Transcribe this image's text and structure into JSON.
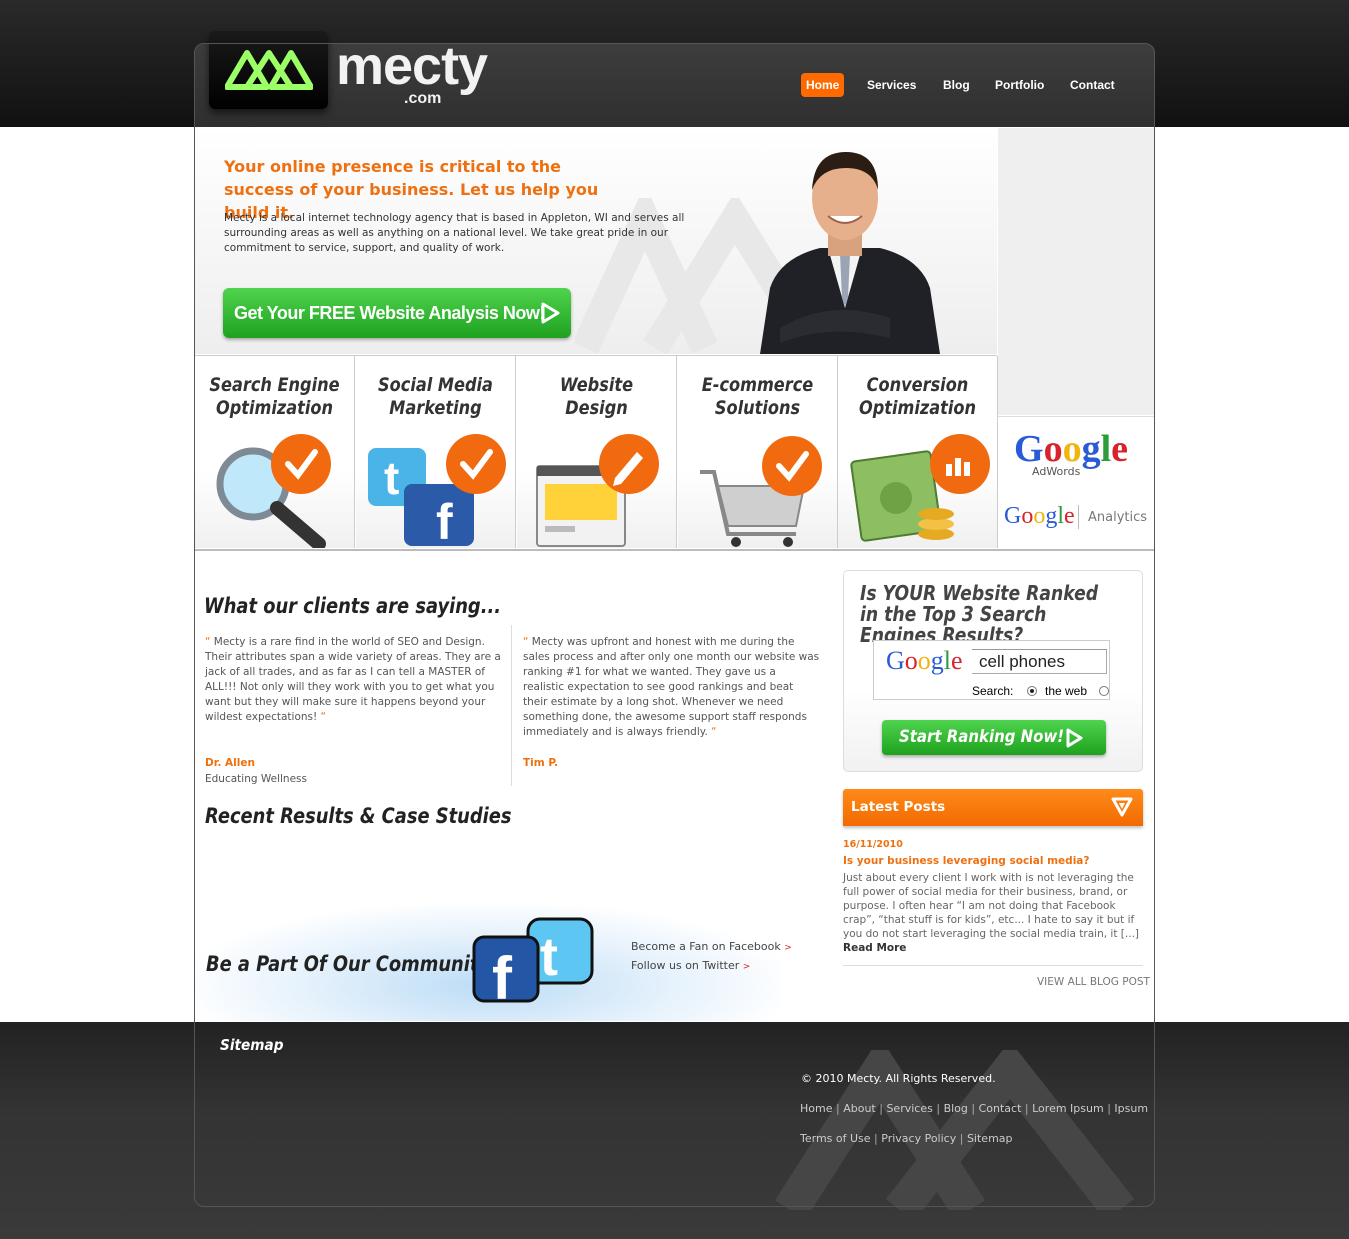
{
  "brand": {
    "name": "mecty",
    "tld": ".com"
  },
  "nav": [
    {
      "label": "Home"
    },
    {
      "label": "Services"
    },
    {
      "label": "Blog"
    },
    {
      "label": "Portfolio"
    },
    {
      "label": "Contact"
    }
  ],
  "hero": {
    "title": "Your online presence is critical to the success of your business. Let us help you build it.",
    "text": "Mecty is a local internet technology agency that is based in Appleton, WI and serves all surrounding areas as well as anything on a national level. We take great pride in our commitment to service, support, and quality of work.",
    "cta": "Get Your FREE Website Analysis Now!"
  },
  "services": [
    {
      "title": "Search Engine Optimization",
      "icon": "magnifier-check-icon"
    },
    {
      "title": "Social Media Marketing",
      "icon": "twitter-facebook-check-icon"
    },
    {
      "title": "Website Design",
      "icon": "browser-pencil-icon"
    },
    {
      "title": "E-commerce Solutions",
      "icon": "cart-check-icon"
    },
    {
      "title": "Conversion Optimization",
      "icon": "money-chart-icon"
    }
  ],
  "google_badges": {
    "adwords_brand": "Google",
    "adwords_label": "AdWords",
    "analytics_brand": "Google",
    "analytics_label": "Analytics"
  },
  "testimonials": {
    "heading": "What our clients are saying...",
    "items": [
      {
        "quote": "Mecty is a rare find in the world of SEO and Design. Their attributes span a wide variety of areas. They are a jack of all trades, and as far as I can tell a MASTER of ALL!!! Not only will they work with you to get what you want but they will make sure it happens beyond your wildest expectations!",
        "author": "Dr. Allen",
        "role": "Educating Wellness"
      },
      {
        "quote": "Mecty was upfront and honest with me during the sales process and after only one month our website was ranking #1 for what we wanted. They gave us a realistic expectation to see good rankings and beat their estimate by a long shot. Whenever we need something done, the awesome support staff responds immediately and is always friendly.",
        "author": "Tim P."
      }
    ]
  },
  "recent_results": {
    "heading": "Recent Results & Case Studies"
  },
  "community": {
    "heading": "Be a Part Of Our Community",
    "facebook_link": "Become a Fan on Facebook",
    "twitter_link": "Follow us on Twitter",
    "arrow": ">"
  },
  "rank_box": {
    "title": "Is YOUR Website Ranked in the Top 3 Search Engines Results?",
    "google_logo": "Google",
    "search_value": "cell phones",
    "search_label": "Search:",
    "radio_option": "the web",
    "button": "Start Ranking Now!"
  },
  "latest_posts": {
    "heading": "Latest Posts",
    "post": {
      "date": "16/11/2010",
      "title": "Is your business leveraging social media?",
      "excerpt": "Just about every client I work with is not leveraging the full power of social media for their business, brand, or purpose. I often hear “I am not doing that Facebook crap”, “that stuff is for kids”, etc... I hate to say it but if you do not start leveraging the social media train, it [...]",
      "read_more": "Read More"
    },
    "view_all": "VIEW ALL BLOG POST"
  },
  "footer": {
    "sitemap": "Sitemap",
    "copyright": "© 2010 Mecty. All Rights Reserved.",
    "links_row1": [
      "Home",
      "About",
      "Services",
      "Blog",
      "Contact",
      "Lorem Ipsum",
      "Ipsum"
    ],
    "links_row2": [
      "Terms of Use",
      "Privacy Policy",
      "Sitemap"
    ],
    "separator": "|"
  },
  "colors": {
    "accent": "#ee7010",
    "green": "#2fb82f",
    "dark": "#333333"
  }
}
